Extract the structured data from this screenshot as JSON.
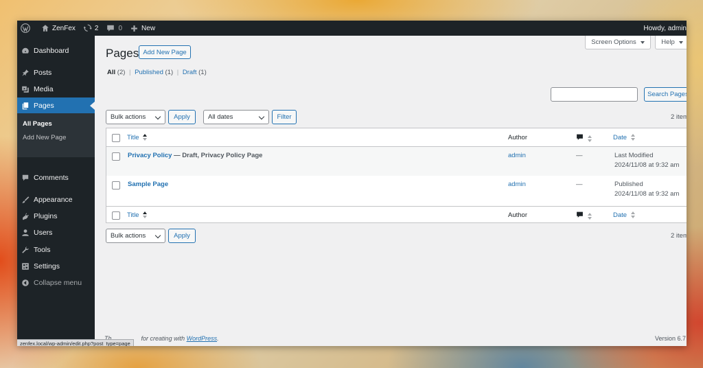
{
  "admin_bar": {
    "site_name": "ZenFex",
    "updates_count": "2",
    "comments_count": "0",
    "new_label": "New",
    "howdy": "Howdy, admin"
  },
  "sidebar": {
    "items": [
      {
        "label": "Dashboard",
        "icon": "dashboard-icon"
      },
      {
        "label": "Posts",
        "icon": "pin-icon"
      },
      {
        "label": "Media",
        "icon": "media-icon"
      },
      {
        "label": "Pages",
        "icon": "pages-icon",
        "active": true
      },
      {
        "label": "Comments",
        "icon": "comment-icon"
      },
      {
        "label": "Appearance",
        "icon": "brush-icon"
      },
      {
        "label": "Plugins",
        "icon": "plugin-icon"
      },
      {
        "label": "Users",
        "icon": "user-icon"
      },
      {
        "label": "Tools",
        "icon": "wrench-icon"
      },
      {
        "label": "Settings",
        "icon": "settings-icon"
      },
      {
        "label": "Collapse menu",
        "icon": "collapse-icon"
      }
    ],
    "submenu": [
      "All Pages",
      "Add New Page"
    ]
  },
  "top_buttons": {
    "screen_options": "Screen Options",
    "help": "Help"
  },
  "page": {
    "title": "Pages",
    "add_new": "Add New Page"
  },
  "filters": {
    "all": "All",
    "all_count": "(2)",
    "published": "Published",
    "published_count": "(1)",
    "draft": "Draft",
    "draft_count": "(1)",
    "separator": "|"
  },
  "search": {
    "button": "Search Pages",
    "value": ""
  },
  "toolbar": {
    "bulk_actions": "Bulk actions",
    "apply": "Apply",
    "all_dates": "All dates",
    "filter": "Filter",
    "item_count": "2 item"
  },
  "table": {
    "columns": {
      "title": "Title",
      "author": "Author",
      "date": "Date"
    },
    "rows": [
      {
        "title": "Privacy Policy",
        "state": "— Draft, Privacy Policy Page",
        "author": "admin",
        "comments": "—",
        "date_status": "Last Modified",
        "date": "2024/11/08 at 9:32 am"
      },
      {
        "title": "Sample Page",
        "state": "",
        "author": "admin",
        "comments": "—",
        "date_status": "Published",
        "date": "2024/11/08 at 9:32 am"
      }
    ]
  },
  "footer": {
    "thanks_prefix": "Th",
    "thanks_suffix": "for creating with",
    "wordpress_link": "WordPress",
    "thanks_end": ".",
    "version": "Version 6.7"
  },
  "statusbar": {
    "url": "zenfex.local/wp-admin/edit.php?post_type=page"
  },
  "colors": {
    "accent": "#2271b1",
    "adminbar_bg": "#1d2327",
    "content_bg": "#f0f0f1"
  }
}
